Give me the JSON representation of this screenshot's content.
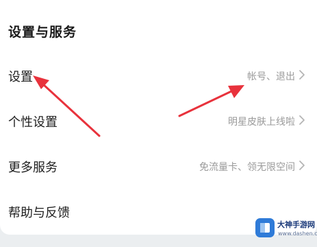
{
  "section": {
    "title": "设置与服务"
  },
  "rows": [
    {
      "label": "设置",
      "value": "帐号、退出"
    },
    {
      "label": "个性设置",
      "value": "明星皮肤上线啦"
    },
    {
      "label": "更多服务",
      "value": "免流量卡、领无限空间"
    },
    {
      "label": "帮助与反馈",
      "value": ""
    }
  ],
  "annotation": {
    "arrow_color": "#e8323c"
  },
  "watermark": {
    "title": "大神手游网",
    "url": "www.dashen.com"
  },
  "colors": {
    "background": "#ebeef0",
    "card": "#ffffff",
    "label": "#1f1f1f",
    "secondary_text": "#9a9a9a",
    "watermark_blue": "#2f7bd8"
  }
}
